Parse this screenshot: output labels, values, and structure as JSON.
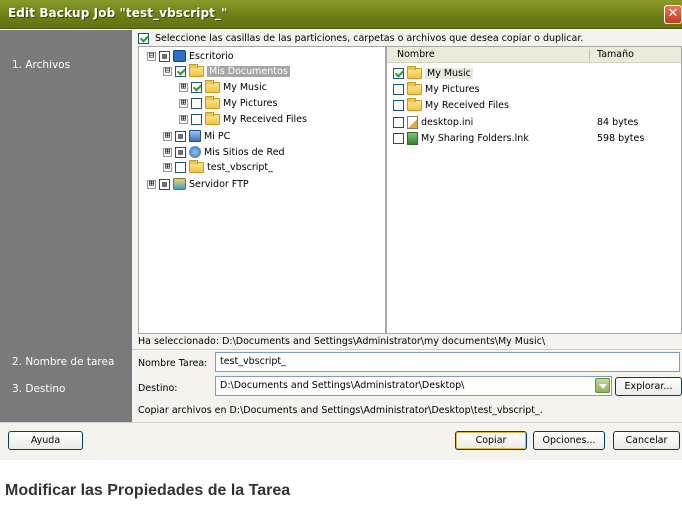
{
  "window": {
    "title": "Edit Backup Job \"test_vbscript_\"",
    "close_glyph": "✕"
  },
  "steps": [
    "1. Archivos",
    "2. Nombre de tarea",
    "3. Destino"
  ],
  "instruction": "Seleccione las casillas de las particiones, carpetas o archivos que desea copiar o duplicar.",
  "tree": [
    {
      "label": "Escritorio",
      "expander": "⊟",
      "check": "partial",
      "icon": "desktop-icon"
    },
    {
      "label": "Mis Documentos",
      "expander": "⊟",
      "check": "checked",
      "icon": "documents-folder-icon",
      "selected": true
    },
    {
      "label": "My Music",
      "expander": "⊞",
      "check": "checked",
      "icon": "folder-icon"
    },
    {
      "label": "My Pictures",
      "expander": "⊞",
      "check": "unchecked",
      "icon": "folder-icon"
    },
    {
      "label": "My Received Files",
      "expander": "⊞",
      "check": "unchecked",
      "icon": "folder-icon"
    },
    {
      "label": "Mi PC",
      "expander": "⊞",
      "check": "partial",
      "icon": "computer-icon"
    },
    {
      "label": "Mis Sitios de Red",
      "expander": "⊞",
      "check": "partial",
      "icon": "network-icon"
    },
    {
      "label": "test_vbscript_",
      "expander": "⊞",
      "check": "unchecked",
      "icon": "folder-icon"
    },
    {
      "label": "Servidor FTP",
      "expander": "⊞",
      "check": "partial",
      "icon": "ftp-server-icon"
    }
  ],
  "files": {
    "columns": [
      "Nombre",
      "Tamaño"
    ],
    "rows": [
      {
        "name": "My Music",
        "size": "",
        "check": "checked",
        "icon": "folder-icon"
      },
      {
        "name": "My Pictures",
        "size": "",
        "check": "unchecked",
        "icon": "folder-icon"
      },
      {
        "name": "My Received Files",
        "size": "",
        "check": "unchecked",
        "icon": "folder-icon"
      },
      {
        "name": "desktop.ini",
        "size": "84 bytes",
        "check": "unchecked",
        "icon": "ini-file-icon"
      },
      {
        "name": "My Sharing Folders.lnk",
        "size": "598 bytes",
        "check": "unchecked",
        "icon": "shortcut-file-icon"
      }
    ]
  },
  "selection_status": "Ha seleccionado: D:\\Documents and Settings\\Administrator\\my documents\\My Music\\",
  "task_name": {
    "label": "Nombre Tarea:",
    "value": "test_vbscript_"
  },
  "destination": {
    "label": "Destino:",
    "value": "D:\\Documents and Settings\\Administrator\\Desktop\\",
    "browse_label": "Explorar..."
  },
  "copy_note": "Copiar archivos en D:\\Documents and Settings\\Administrator\\Desktop\\test_vbscript_.",
  "buttons": {
    "help": "Ayuda",
    "copy": "Copiar",
    "options": "Opciones...",
    "cancel": "Cancelar"
  },
  "caption": "Modificar las Propiedades de la Tarea",
  "colors": {
    "titlebar": "#6f7f14",
    "sidebar": "#7a7a7a",
    "panel": "#f4f3ee"
  }
}
